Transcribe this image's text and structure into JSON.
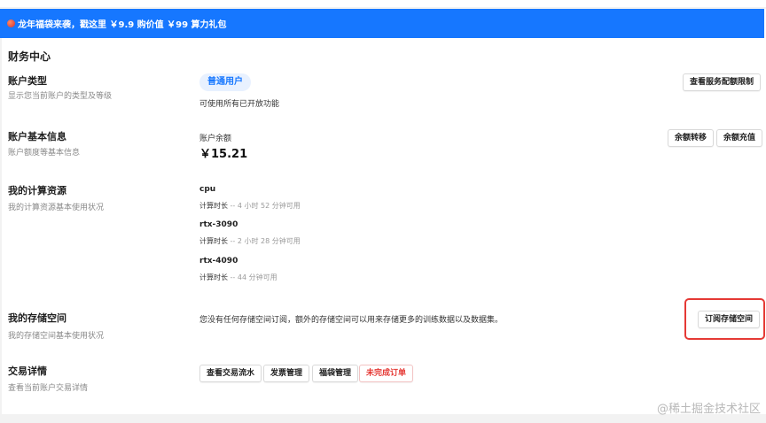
{
  "banner": {
    "icon": "red-envelope-icon",
    "text": "龙年福袋来袭，戳这里 ￥9.9 购价值 ￥99 算力礼包"
  },
  "page_title": "财务中心",
  "account_type": {
    "title": "账户类型",
    "desc": "显示您当前账户的类型及等级",
    "badge": "普通用户",
    "note": "可使用所有已开放功能",
    "button": "查看服务配额限制"
  },
  "balance": {
    "title": "账户基本信息",
    "desc": "账户额度等基本信息",
    "label": "账户余额",
    "amount": "￥15.21",
    "transfer_button": "余额转移",
    "recharge_button": "余额充值"
  },
  "compute": {
    "title": "我的计算资源",
    "desc": "我的计算资源基本使用状况",
    "label_prefix": "计算时长",
    "resources": [
      {
        "name": "cpu",
        "time": "-- 4 小时 52 分钟可用"
      },
      {
        "name": "rtx-3090",
        "time": "-- 2 小时 28 分钟可用"
      },
      {
        "name": "rtx-4090",
        "time": "-- 44 分钟可用"
      }
    ]
  },
  "storage": {
    "title": "我的存储空间",
    "desc": "我的存储空间基本使用状况",
    "message": "您没有任何存储空间订阅，额外的存储空间可以用来存储更多的训练数据以及数据集。",
    "subscribe_button": "订阅存储空间"
  },
  "transactions": {
    "title": "交易详情",
    "desc": "查看当前账户交易详情",
    "buttons": [
      "查看交易流水",
      "发票管理",
      "福袋管理",
      "未完成订单"
    ]
  },
  "watermark": "@稀土掘金技术社区",
  "colors": {
    "banner": "#1677ff",
    "badge_bg": "#e8f1ff",
    "badge_text": "#1677ff",
    "danger": "#e53935"
  }
}
